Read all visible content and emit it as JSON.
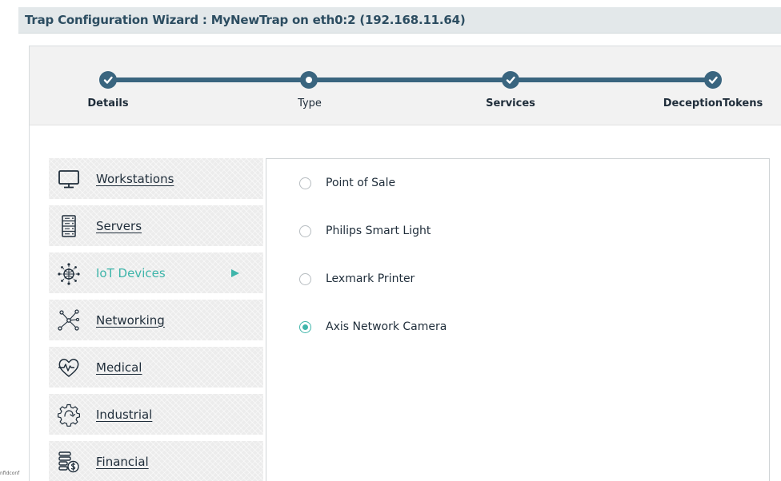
{
  "header": {
    "title": "Trap Configuration Wizard : MyNewTrap on eth0:2 (192.168.11.64)"
  },
  "wizard": {
    "steps": [
      {
        "label": "Details",
        "state": "done"
      },
      {
        "label": "Type",
        "state": "current"
      },
      {
        "label": "Services",
        "state": "done"
      },
      {
        "label": "DeceptionTokens",
        "state": "done"
      }
    ]
  },
  "categories": {
    "items": [
      {
        "label": "Workstations",
        "icon": "monitor-icon",
        "active": false
      },
      {
        "label": "Servers",
        "icon": "server-rack-icon",
        "active": false
      },
      {
        "label": "IoT Devices",
        "icon": "iot-globe-icon",
        "active": true
      },
      {
        "label": "Networking",
        "icon": "network-nodes-icon",
        "active": false
      },
      {
        "label": "Medical",
        "icon": "heart-pulse-icon",
        "active": false
      },
      {
        "label": "Industrial",
        "icon": "gear-icon",
        "active": false
      },
      {
        "label": "Financial",
        "icon": "coins-icon",
        "active": false
      }
    ]
  },
  "device_types": {
    "options": [
      {
        "label": "Point of Sale",
        "selected": false
      },
      {
        "label": "Philips Smart Light",
        "selected": false
      },
      {
        "label": "Lexmark Printer",
        "selected": false
      },
      {
        "label": "Axis Network Camera",
        "selected": true
      }
    ]
  },
  "footer": {
    "corner_text": "nfidconf"
  },
  "colors": {
    "primary": "#3a657f",
    "accent": "#3fb5aa",
    "title_text": "#2c4d61"
  }
}
